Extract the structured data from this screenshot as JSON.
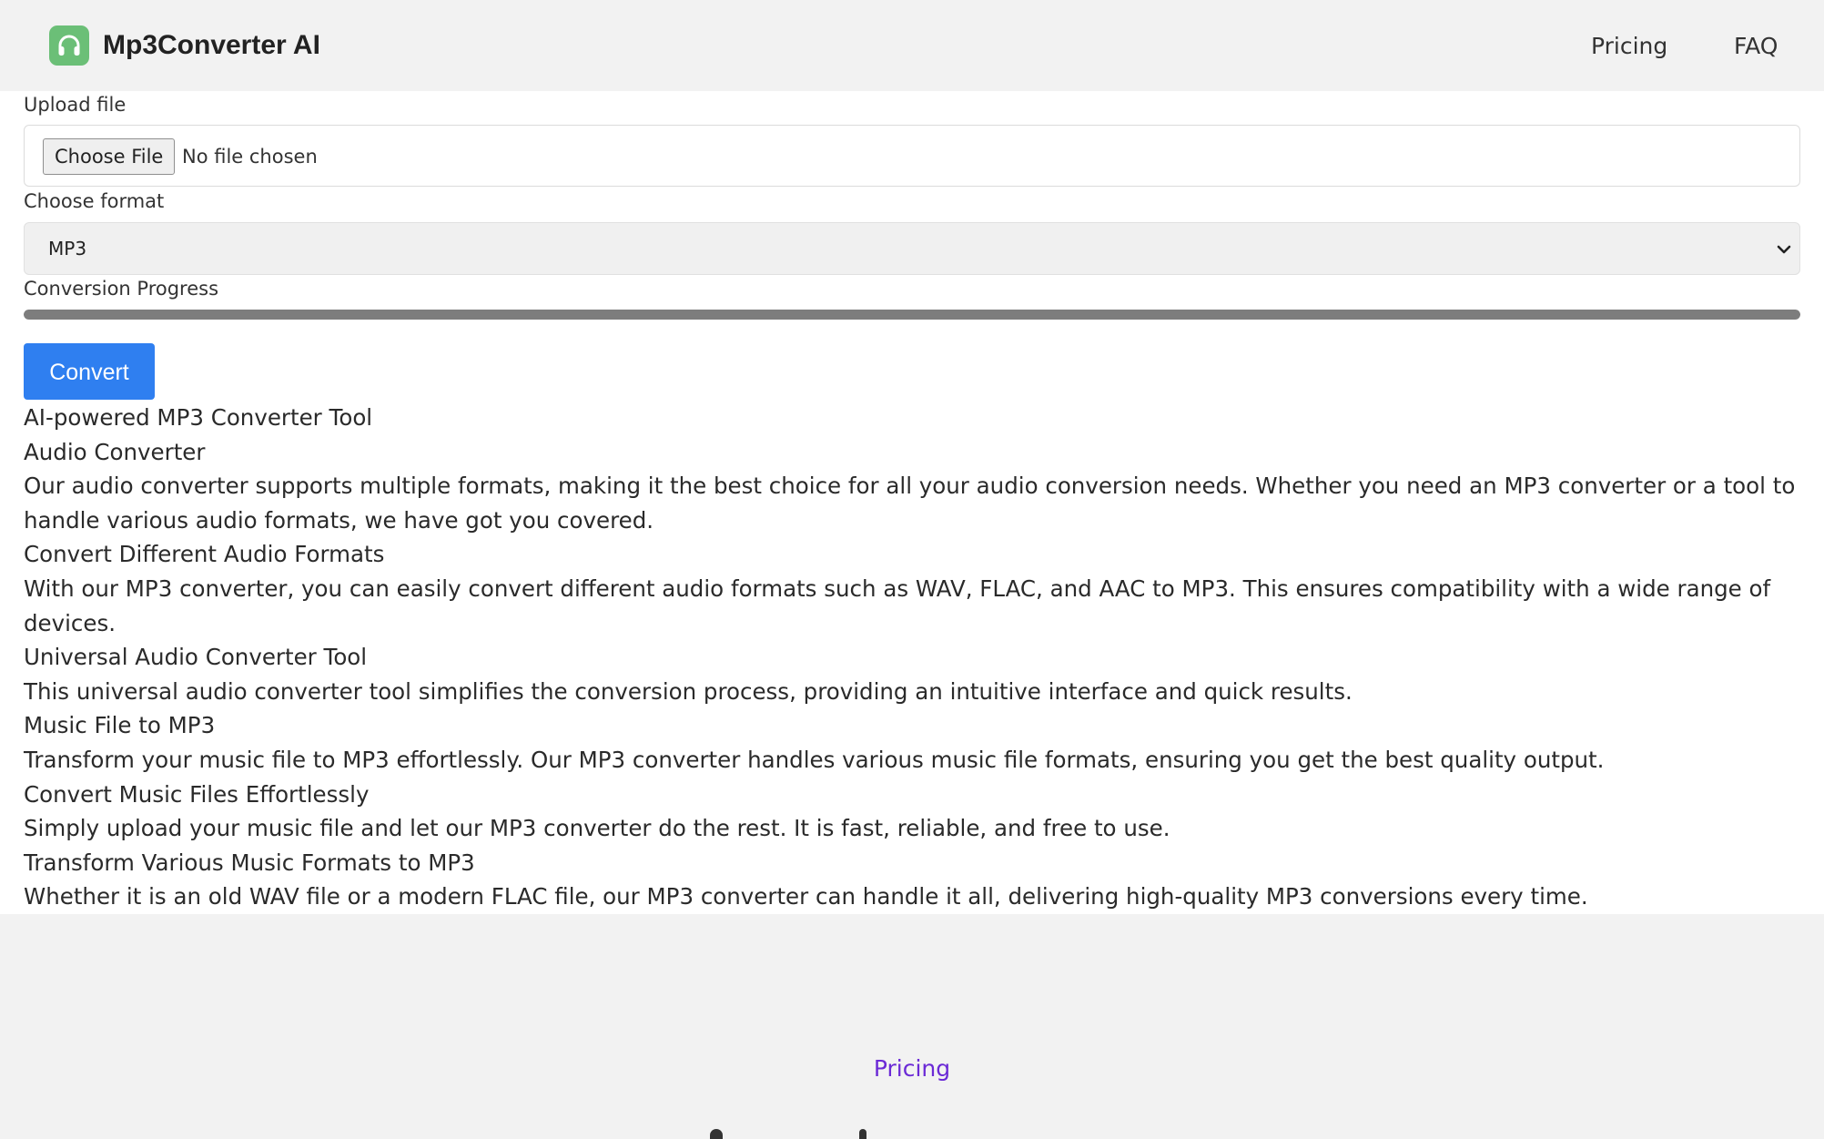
{
  "header": {
    "brand": "Mp3Converter AI",
    "logo_icon": "headphones-icon",
    "nav": [
      "Pricing",
      "FAQ"
    ]
  },
  "form": {
    "upload_label": "Upload file",
    "file_button": "Choose File",
    "file_status": "No file chosen",
    "format_label": "Choose format",
    "format_selected": "MP3",
    "progress_label": "Conversion Progress",
    "progress_value": 1.0,
    "convert_label": "Convert"
  },
  "content": [
    "AI-powered MP3 Converter Tool",
    "Audio Converter",
    "Our audio converter supports multiple formats, making it the best choice for all your audio conversion needs. Whether you need an MP3 converter or a tool to handle various audio formats, we have got you covered.",
    "Convert Different Audio Formats",
    "With our MP3 converter, you can easily convert different audio formats such as WAV, FLAC, and AAC to MP3. This ensures compatibility with a wide range of devices.",
    "Universal Audio Converter Tool",
    "This universal audio converter tool simplifies the conversion process, providing an intuitive interface and quick results.",
    "Music File to MP3",
    "Transform your music file to MP3 effortlessly. Our MP3 converter handles various music file formats, ensuring you get the best quality output.",
    "Convert Music Files Effortlessly",
    "Simply upload your music file and let our MP3 converter do the rest. It is fast, reliable, and free to use.",
    "Transform Various Music Formats to MP3",
    "Whether it is an old WAV file or a modern FLAC file, our MP3 converter can handle it all, delivering high-quality MP3 conversions every time."
  ],
  "footer": {
    "link": "Pricing"
  },
  "colors": {
    "accent": "#2f7ff0",
    "footer_link": "#6b2ad6",
    "logo_bg": "#6bbf77"
  }
}
